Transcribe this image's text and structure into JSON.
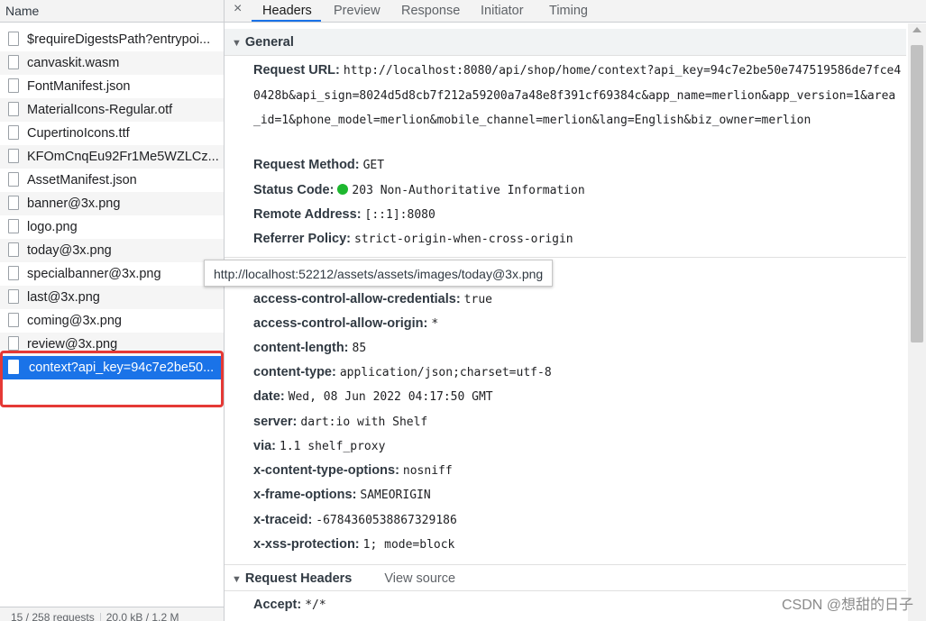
{
  "left": {
    "header": "Name",
    "rows": [
      "$requireDigestsPath?entrypoi...",
      "canvaskit.wasm",
      "FontManifest.json",
      "MaterialIcons-Regular.otf",
      "CupertinoIcons.ttf",
      "KFOmCnqEu92Fr1Me5WZLCz...",
      "AssetManifest.json",
      "banner@3x.png",
      "logo.png",
      "today@3x.png",
      "specialbanner@3x.png",
      "last@3x.png",
      "coming@3x.png",
      "review@3x.png"
    ],
    "selected": "context?api_key=94c7e2be50...",
    "footer_requests": "15 / 258 requests",
    "footer_size": "20.0 kB / 1.2 M"
  },
  "tabs": {
    "close": "×",
    "headers": "Headers",
    "preview": "Preview",
    "response": "Response",
    "initiator": "Initiator",
    "timing": "Timing"
  },
  "general": {
    "title": "General",
    "request_url_label": "Request URL:",
    "request_url": "http://localhost:8080/api/shop/home/context?api_key=94c7e2be50e747519586de7fce40428b&api_sign=8024d5d8cb7f212a59200a7a48e8f391cf69384c&app_name=merlion&app_version=1&area_id=1&phone_model=merlion&mobile_channel=merlion&lang=English&biz_owner=merlion",
    "request_method_label": "Request Method:",
    "request_method": "GET",
    "status_code_label": "Status Code:",
    "status_code": "203 Non-Authoritative Information",
    "status_color": "#1db72f",
    "remote_address_label": "Remote Address:",
    "remote_address": "[::1]:8080",
    "referrer_policy_label": "Referrer Policy:",
    "referrer_policy": "strict-origin-when-cross-origin"
  },
  "tooltip": "http://localhost:52212/assets/assets/images/today@3x.png",
  "response_headers": [
    {
      "k": "access-control-allow-credentials:",
      "v": "true"
    },
    {
      "k": "access-control-allow-origin:",
      "v": "*"
    },
    {
      "k": "content-length:",
      "v": "85"
    },
    {
      "k": "content-type:",
      "v": "application/json;charset=utf-8"
    },
    {
      "k": "date:",
      "v": "Wed, 08 Jun 2022 04:17:50 GMT"
    },
    {
      "k": "server:",
      "v": "dart:io with Shelf"
    },
    {
      "k": "via:",
      "v": "1.1 shelf_proxy"
    },
    {
      "k": "x-content-type-options:",
      "v": "nosniff"
    },
    {
      "k": "x-frame-options:",
      "v": "SAMEORIGIN"
    },
    {
      "k": "x-traceid:",
      "v": "-6784360538867329186"
    },
    {
      "k": "x-xss-protection:",
      "v": "1; mode=block"
    }
  ],
  "request_headers": {
    "title": "Request Headers",
    "view_source": "View source",
    "accept_label": "Accept:",
    "accept": "*/*"
  },
  "watermark": "CSDN @想甜的日子",
  "colors": {
    "accent": "#1a73e8",
    "highlight_box": "#e53935"
  }
}
